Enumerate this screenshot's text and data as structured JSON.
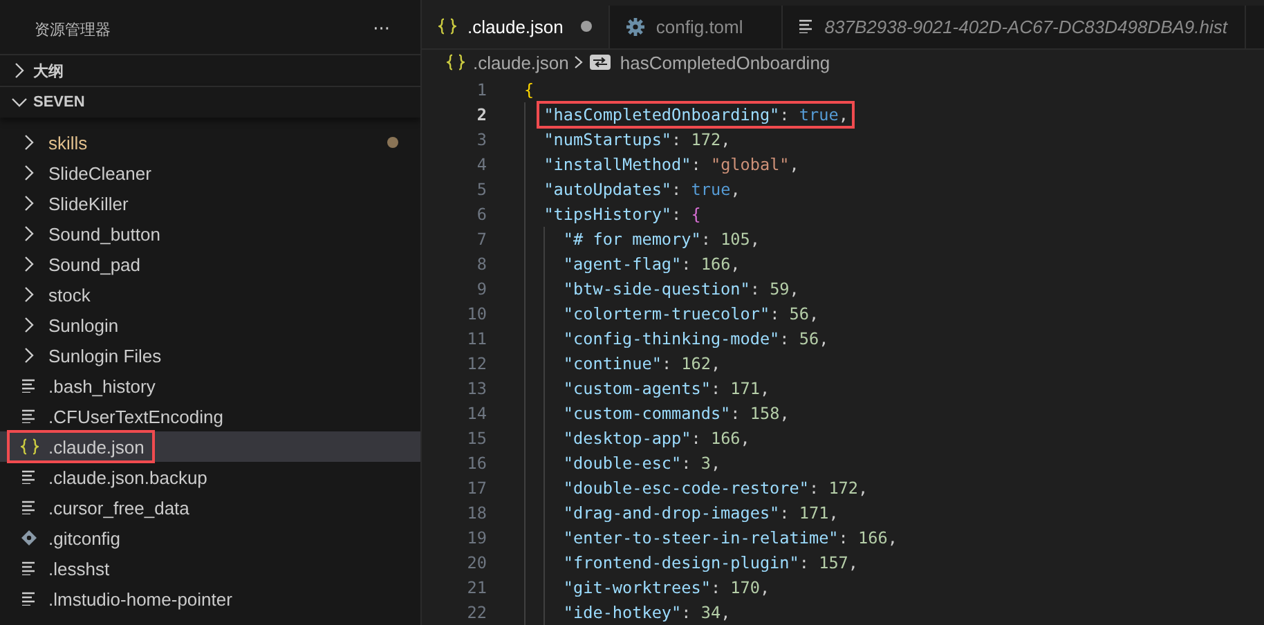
{
  "sidebar": {
    "title": "资源管理器",
    "more": "···",
    "sections": [
      {
        "label": "大纲",
        "expanded": false
      },
      {
        "label": "SEVEN",
        "expanded": true
      }
    ],
    "items": [
      {
        "kind": "folder",
        "label": "skills",
        "modified": true,
        "selected": false,
        "annotated": false
      },
      {
        "kind": "folder",
        "label": "SlideCleaner",
        "modified": false,
        "selected": false,
        "annotated": false
      },
      {
        "kind": "folder",
        "label": "SlideKiller",
        "modified": false,
        "selected": false,
        "annotated": false
      },
      {
        "kind": "folder",
        "label": "Sound_button",
        "modified": false,
        "selected": false,
        "annotated": false
      },
      {
        "kind": "folder",
        "label": "Sound_pad",
        "modified": false,
        "selected": false,
        "annotated": false
      },
      {
        "kind": "folder",
        "label": "stock",
        "modified": false,
        "selected": false,
        "annotated": false
      },
      {
        "kind": "folder",
        "label": "Sunlogin",
        "modified": false,
        "selected": false,
        "annotated": false
      },
      {
        "kind": "folder",
        "label": "Sunlogin Files",
        "modified": false,
        "selected": false,
        "annotated": false
      },
      {
        "kind": "text-file",
        "label": ".bash_history",
        "modified": false,
        "selected": false,
        "annotated": false
      },
      {
        "kind": "text-file",
        "label": ".CFUserTextEncoding",
        "modified": false,
        "selected": false,
        "annotated": false
      },
      {
        "kind": "json-file",
        "label": ".claude.json",
        "modified": false,
        "selected": true,
        "annotated": true
      },
      {
        "kind": "text-file",
        "label": ".claude.json.backup",
        "modified": false,
        "selected": false,
        "annotated": false
      },
      {
        "kind": "text-file",
        "label": ".cursor_free_data",
        "modified": false,
        "selected": false,
        "annotated": false
      },
      {
        "kind": "git-file",
        "label": ".gitconfig",
        "modified": false,
        "selected": false,
        "annotated": false
      },
      {
        "kind": "text-file",
        "label": ".lesshst",
        "modified": false,
        "selected": false,
        "annotated": false
      },
      {
        "kind": "text-file",
        "label": ".lmstudio-home-pointer",
        "modified": false,
        "selected": false,
        "annotated": false
      }
    ]
  },
  "tabs": [
    {
      "kind": "json",
      "label": ".claude.json",
      "selected": true,
      "modified": true,
      "preview": false
    },
    {
      "kind": "settings",
      "label": "config.toml",
      "selected": false,
      "modified": false,
      "preview": false
    },
    {
      "kind": "text",
      "label": "837B2938-9021-402D-AC67-DC83D498DBA9.hist",
      "selected": false,
      "modified": false,
      "preview": true
    }
  ],
  "breadcrumb": [
    {
      "kind": "json",
      "label": ".claude.json"
    },
    {
      "kind": "property",
      "label": "hasCompletedOnboarding"
    }
  ],
  "editor": {
    "lines": [
      {
        "number": "1",
        "current": false,
        "annotated": false,
        "tokens": [
          {
            "kind": "brace-outer",
            "text": "{"
          }
        ],
        "children": [
          {
            "number": "2",
            "current": true,
            "annotated": true,
            "tokens": [
              {
                "kind": "key",
                "text": "\"hasCompletedOnboarding\""
              },
              {
                "kind": "punct",
                "text": ": "
              },
              {
                "kind": "bool",
                "text": "true"
              },
              {
                "kind": "punct",
                "text": ","
              }
            ]
          },
          {
            "number": "3",
            "current": false,
            "annotated": false,
            "tokens": [
              {
                "kind": "key",
                "text": "\"numStartups\""
              },
              {
                "kind": "punct",
                "text": ": "
              },
              {
                "kind": "number",
                "text": "172"
              },
              {
                "kind": "punct",
                "text": ","
              }
            ]
          },
          {
            "number": "4",
            "current": false,
            "annotated": false,
            "tokens": [
              {
                "kind": "key",
                "text": "\"installMethod\""
              },
              {
                "kind": "punct",
                "text": ": "
              },
              {
                "kind": "string",
                "text": "\"global\""
              },
              {
                "kind": "punct",
                "text": ","
              }
            ]
          },
          {
            "number": "5",
            "current": false,
            "annotated": false,
            "tokens": [
              {
                "kind": "key",
                "text": "\"autoUpdates\""
              },
              {
                "kind": "punct",
                "text": ": "
              },
              {
                "kind": "bool",
                "text": "true"
              },
              {
                "kind": "punct",
                "text": ","
              }
            ]
          },
          {
            "number": "6",
            "current": false,
            "annotated": false,
            "tokens": [
              {
                "kind": "key",
                "text": "\"tipsHistory\""
              },
              {
                "kind": "punct",
                "text": ": "
              },
              {
                "kind": "brace-inner",
                "text": "{"
              }
            ],
            "children": [
              {
                "number": "7",
                "current": false,
                "annotated": false,
                "tokens": [
                  {
                    "kind": "key",
                    "text": "\"# for memory\""
                  },
                  {
                    "kind": "punct",
                    "text": ": "
                  },
                  {
                    "kind": "number",
                    "text": "105"
                  },
                  {
                    "kind": "punct",
                    "text": ","
                  }
                ]
              },
              {
                "number": "8",
                "current": false,
                "annotated": false,
                "tokens": [
                  {
                    "kind": "key",
                    "text": "\"agent-flag\""
                  },
                  {
                    "kind": "punct",
                    "text": ": "
                  },
                  {
                    "kind": "number",
                    "text": "166"
                  },
                  {
                    "kind": "punct",
                    "text": ","
                  }
                ]
              },
              {
                "number": "9",
                "current": false,
                "annotated": false,
                "tokens": [
                  {
                    "kind": "key",
                    "text": "\"btw-side-question\""
                  },
                  {
                    "kind": "punct",
                    "text": ": "
                  },
                  {
                    "kind": "number",
                    "text": "59"
                  },
                  {
                    "kind": "punct",
                    "text": ","
                  }
                ]
              },
              {
                "number": "10",
                "current": false,
                "annotated": false,
                "tokens": [
                  {
                    "kind": "key",
                    "text": "\"colorterm-truecolor\""
                  },
                  {
                    "kind": "punct",
                    "text": ": "
                  },
                  {
                    "kind": "number",
                    "text": "56"
                  },
                  {
                    "kind": "punct",
                    "text": ","
                  }
                ]
              },
              {
                "number": "11",
                "current": false,
                "annotated": false,
                "tokens": [
                  {
                    "kind": "key",
                    "text": "\"config-thinking-mode\""
                  },
                  {
                    "kind": "punct",
                    "text": ": "
                  },
                  {
                    "kind": "number",
                    "text": "56"
                  },
                  {
                    "kind": "punct",
                    "text": ","
                  }
                ]
              },
              {
                "number": "12",
                "current": false,
                "annotated": false,
                "tokens": [
                  {
                    "kind": "key",
                    "text": "\"continue\""
                  },
                  {
                    "kind": "punct",
                    "text": ": "
                  },
                  {
                    "kind": "number",
                    "text": "162"
                  },
                  {
                    "kind": "punct",
                    "text": ","
                  }
                ]
              },
              {
                "number": "13",
                "current": false,
                "annotated": false,
                "tokens": [
                  {
                    "kind": "key",
                    "text": "\"custom-agents\""
                  },
                  {
                    "kind": "punct",
                    "text": ": "
                  },
                  {
                    "kind": "number",
                    "text": "171"
                  },
                  {
                    "kind": "punct",
                    "text": ","
                  }
                ]
              },
              {
                "number": "14",
                "current": false,
                "annotated": false,
                "tokens": [
                  {
                    "kind": "key",
                    "text": "\"custom-commands\""
                  },
                  {
                    "kind": "punct",
                    "text": ": "
                  },
                  {
                    "kind": "number",
                    "text": "158"
                  },
                  {
                    "kind": "punct",
                    "text": ","
                  }
                ]
              },
              {
                "number": "15",
                "current": false,
                "annotated": false,
                "tokens": [
                  {
                    "kind": "key",
                    "text": "\"desktop-app\""
                  },
                  {
                    "kind": "punct",
                    "text": ": "
                  },
                  {
                    "kind": "number",
                    "text": "166"
                  },
                  {
                    "kind": "punct",
                    "text": ","
                  }
                ]
              },
              {
                "number": "16",
                "current": false,
                "annotated": false,
                "tokens": [
                  {
                    "kind": "key",
                    "text": "\"double-esc\""
                  },
                  {
                    "kind": "punct",
                    "text": ": "
                  },
                  {
                    "kind": "number",
                    "text": "3"
                  },
                  {
                    "kind": "punct",
                    "text": ","
                  }
                ]
              },
              {
                "number": "17",
                "current": false,
                "annotated": false,
                "tokens": [
                  {
                    "kind": "key",
                    "text": "\"double-esc-code-restore\""
                  },
                  {
                    "kind": "punct",
                    "text": ": "
                  },
                  {
                    "kind": "number",
                    "text": "172"
                  },
                  {
                    "kind": "punct",
                    "text": ","
                  }
                ]
              },
              {
                "number": "18",
                "current": false,
                "annotated": false,
                "tokens": [
                  {
                    "kind": "key",
                    "text": "\"drag-and-drop-images\""
                  },
                  {
                    "kind": "punct",
                    "text": ": "
                  },
                  {
                    "kind": "number",
                    "text": "171"
                  },
                  {
                    "kind": "punct",
                    "text": ","
                  }
                ]
              },
              {
                "number": "19",
                "current": false,
                "annotated": false,
                "tokens": [
                  {
                    "kind": "key",
                    "text": "\"enter-to-steer-in-relatime\""
                  },
                  {
                    "kind": "punct",
                    "text": ": "
                  },
                  {
                    "kind": "number",
                    "text": "166"
                  },
                  {
                    "kind": "punct",
                    "text": ","
                  }
                ]
              },
              {
                "number": "20",
                "current": false,
                "annotated": false,
                "tokens": [
                  {
                    "kind": "key",
                    "text": "\"frontend-design-plugin\""
                  },
                  {
                    "kind": "punct",
                    "text": ": "
                  },
                  {
                    "kind": "number",
                    "text": "157"
                  },
                  {
                    "kind": "punct",
                    "text": ","
                  }
                ]
              },
              {
                "number": "21",
                "current": false,
                "annotated": false,
                "tokens": [
                  {
                    "kind": "key",
                    "text": "\"git-worktrees\""
                  },
                  {
                    "kind": "punct",
                    "text": ": "
                  },
                  {
                    "kind": "number",
                    "text": "170"
                  },
                  {
                    "kind": "punct",
                    "text": ","
                  }
                ]
              },
              {
                "number": "22",
                "current": false,
                "annotated": false,
                "tokens": [
                  {
                    "kind": "key",
                    "text": "\"ide-hotkey\""
                  },
                  {
                    "kind": "punct",
                    "text": ": "
                  },
                  {
                    "kind": "number",
                    "text": "34"
                  },
                  {
                    "kind": "punct",
                    "text": ","
                  }
                ]
              }
            ]
          }
        ]
      }
    ]
  }
}
